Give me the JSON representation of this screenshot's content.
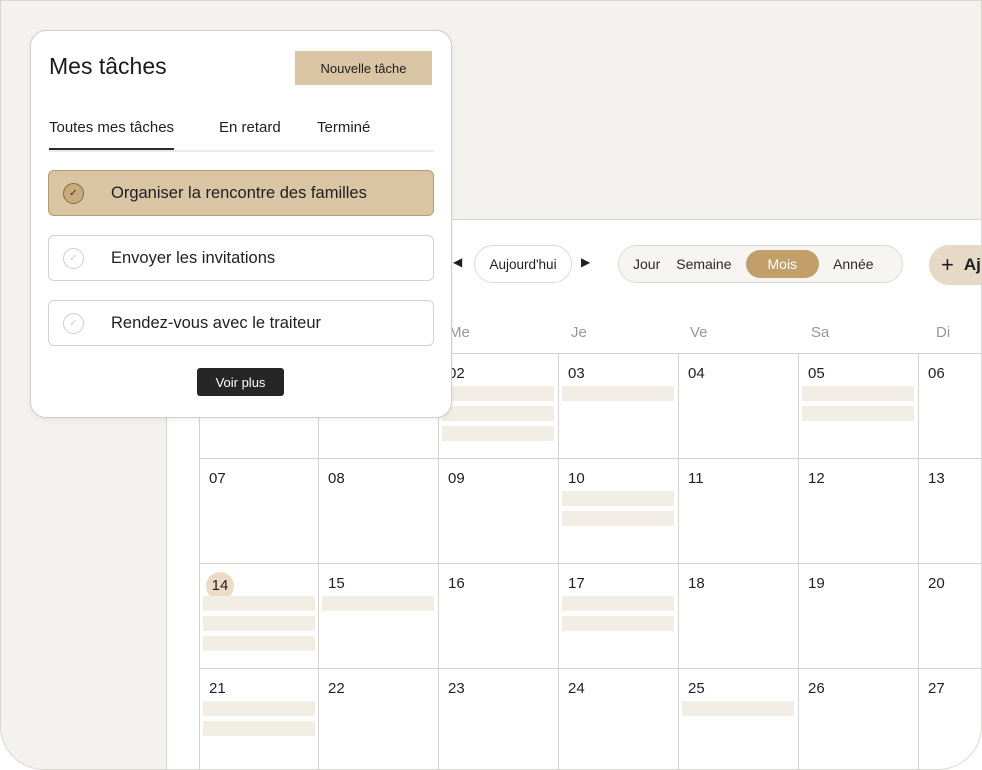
{
  "tasks_panel": {
    "title": "Mes tâches",
    "new_task_label": "Nouvelle tâche",
    "tabs": [
      "Toutes mes tâches",
      "En retard",
      "Terminé"
    ],
    "items": [
      {
        "label": "Organiser la rencontre des familles",
        "selected": true
      },
      {
        "label": "Envoyer les invitations",
        "selected": false
      },
      {
        "label": "Rendez-vous avec le traiteur",
        "selected": false
      }
    ],
    "see_more_label": "Voir plus"
  },
  "calendar": {
    "prev_icon": "triangle-left",
    "next_icon": "triangle-right",
    "today_label": "Aujourd'hui",
    "views": [
      "Jour",
      "Semaine",
      "Mois",
      "Année"
    ],
    "active_view": "Mois",
    "add_label": "Aj",
    "weekdays": [
      "Me",
      "Je",
      "Ve",
      "Sa",
      "Di"
    ],
    "weeks": [
      [
        "",
        "",
        "02",
        "03",
        "04",
        "05",
        "06"
      ],
      [
        "07",
        "08",
        "09",
        "10",
        "11",
        "12",
        "13"
      ],
      [
        "14",
        "15",
        "16",
        "17",
        "18",
        "19",
        "20"
      ],
      [
        "21",
        "22",
        "23",
        "24",
        "25",
        "26",
        "27"
      ]
    ],
    "today": "14",
    "events_per_cell": [
      [
        0,
        0,
        3,
        1,
        0,
        2,
        0
      ],
      [
        0,
        0,
        0,
        2,
        0,
        0,
        0
      ],
      [
        3,
        1,
        0,
        2,
        0,
        0,
        0
      ],
      [
        2,
        0,
        0,
        0,
        1,
        0,
        0
      ]
    ],
    "colors": {
      "accent": "#c29e6b",
      "event": "#f3eee5",
      "today": "#ecdcc5"
    }
  }
}
